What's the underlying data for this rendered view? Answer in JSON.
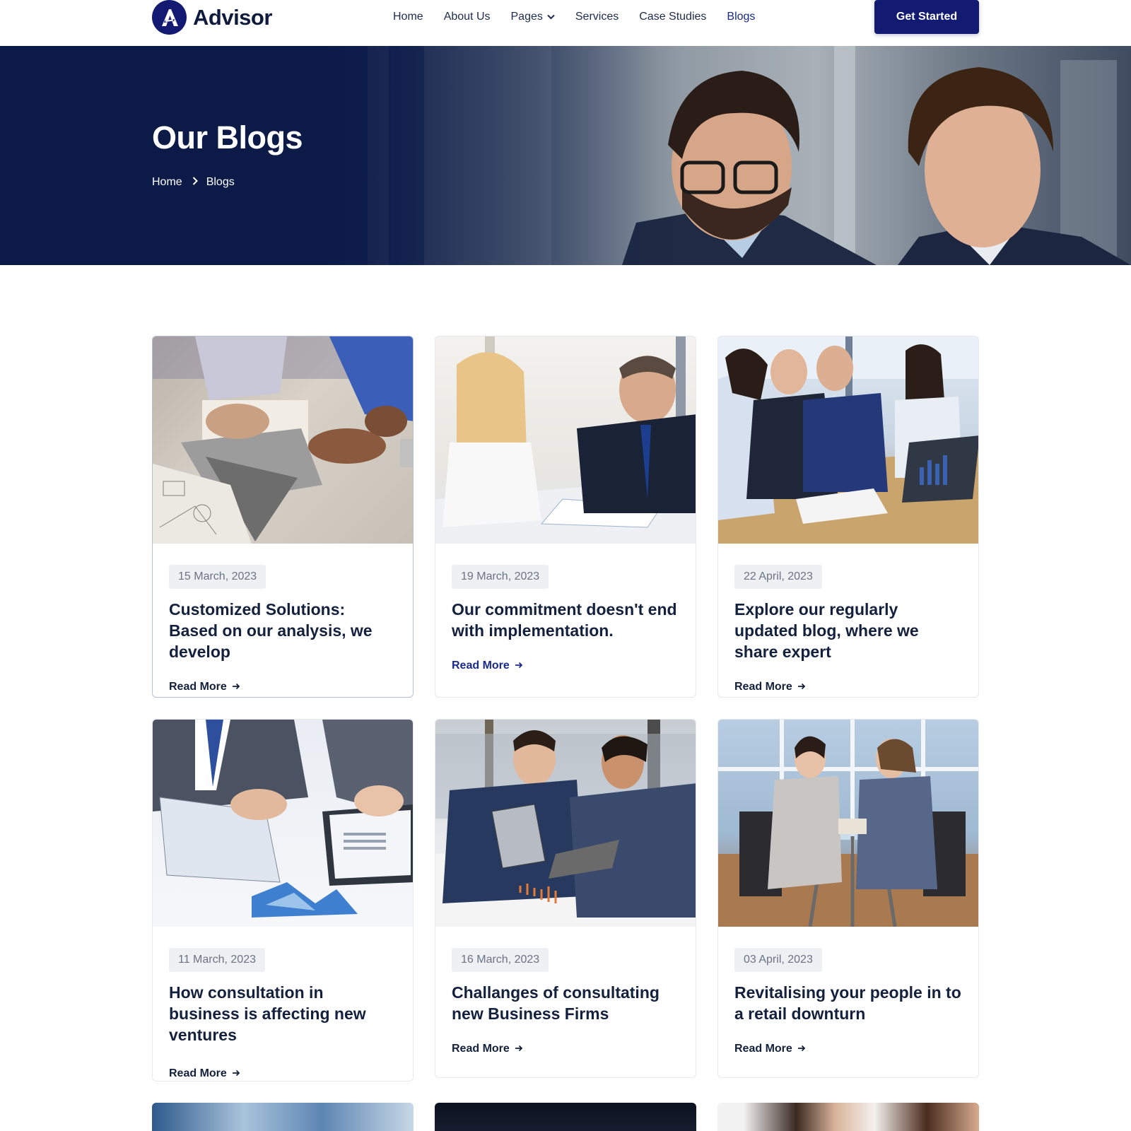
{
  "brand": {
    "name": "Advisor",
    "color": "#121a72"
  },
  "nav": {
    "items": [
      {
        "label": "Home"
      },
      {
        "label": "About Us"
      },
      {
        "label": "Pages"
      },
      {
        "label": "Services"
      },
      {
        "label": "Case Studies"
      },
      {
        "label": "Blogs"
      }
    ],
    "cta": "Get Started"
  },
  "hero": {
    "title": "Our Blogs",
    "breadcrumb": [
      "Home",
      "Blogs"
    ]
  },
  "posts": [
    {
      "date": "15 March, 2023",
      "title": "Customized Solutions: Based on our analysis, we develop",
      "link": "Read More",
      "image": "business-hands-tablet-photo"
    },
    {
      "date": "19 March, 2023",
      "title": "Our commitment doesn't end with implementation.",
      "link": "Read More",
      "image": "woman-and-man-reviewing-documents-photo"
    },
    {
      "date": "22 April, 2023",
      "title": "Explore our regularly updated blog, where we share expert",
      "link": "Read More",
      "image": "team-meeting-laptop-photo"
    },
    {
      "date": "11 March, 2023",
      "title": "How consultation in business is affecting new ventures",
      "link": "Read More",
      "image": "charts-paperwork-hands-photo"
    },
    {
      "date": "16 March, 2023",
      "title": "Challanges of consultating new Business Firms",
      "link": "Read More",
      "image": "two-men-with-tablet-photo"
    },
    {
      "date": "03 April, 2023",
      "title": "Revitalising your people in to a retail downturn",
      "link": "Read More",
      "image": "two-women-cafe-table-photo"
    }
  ]
}
